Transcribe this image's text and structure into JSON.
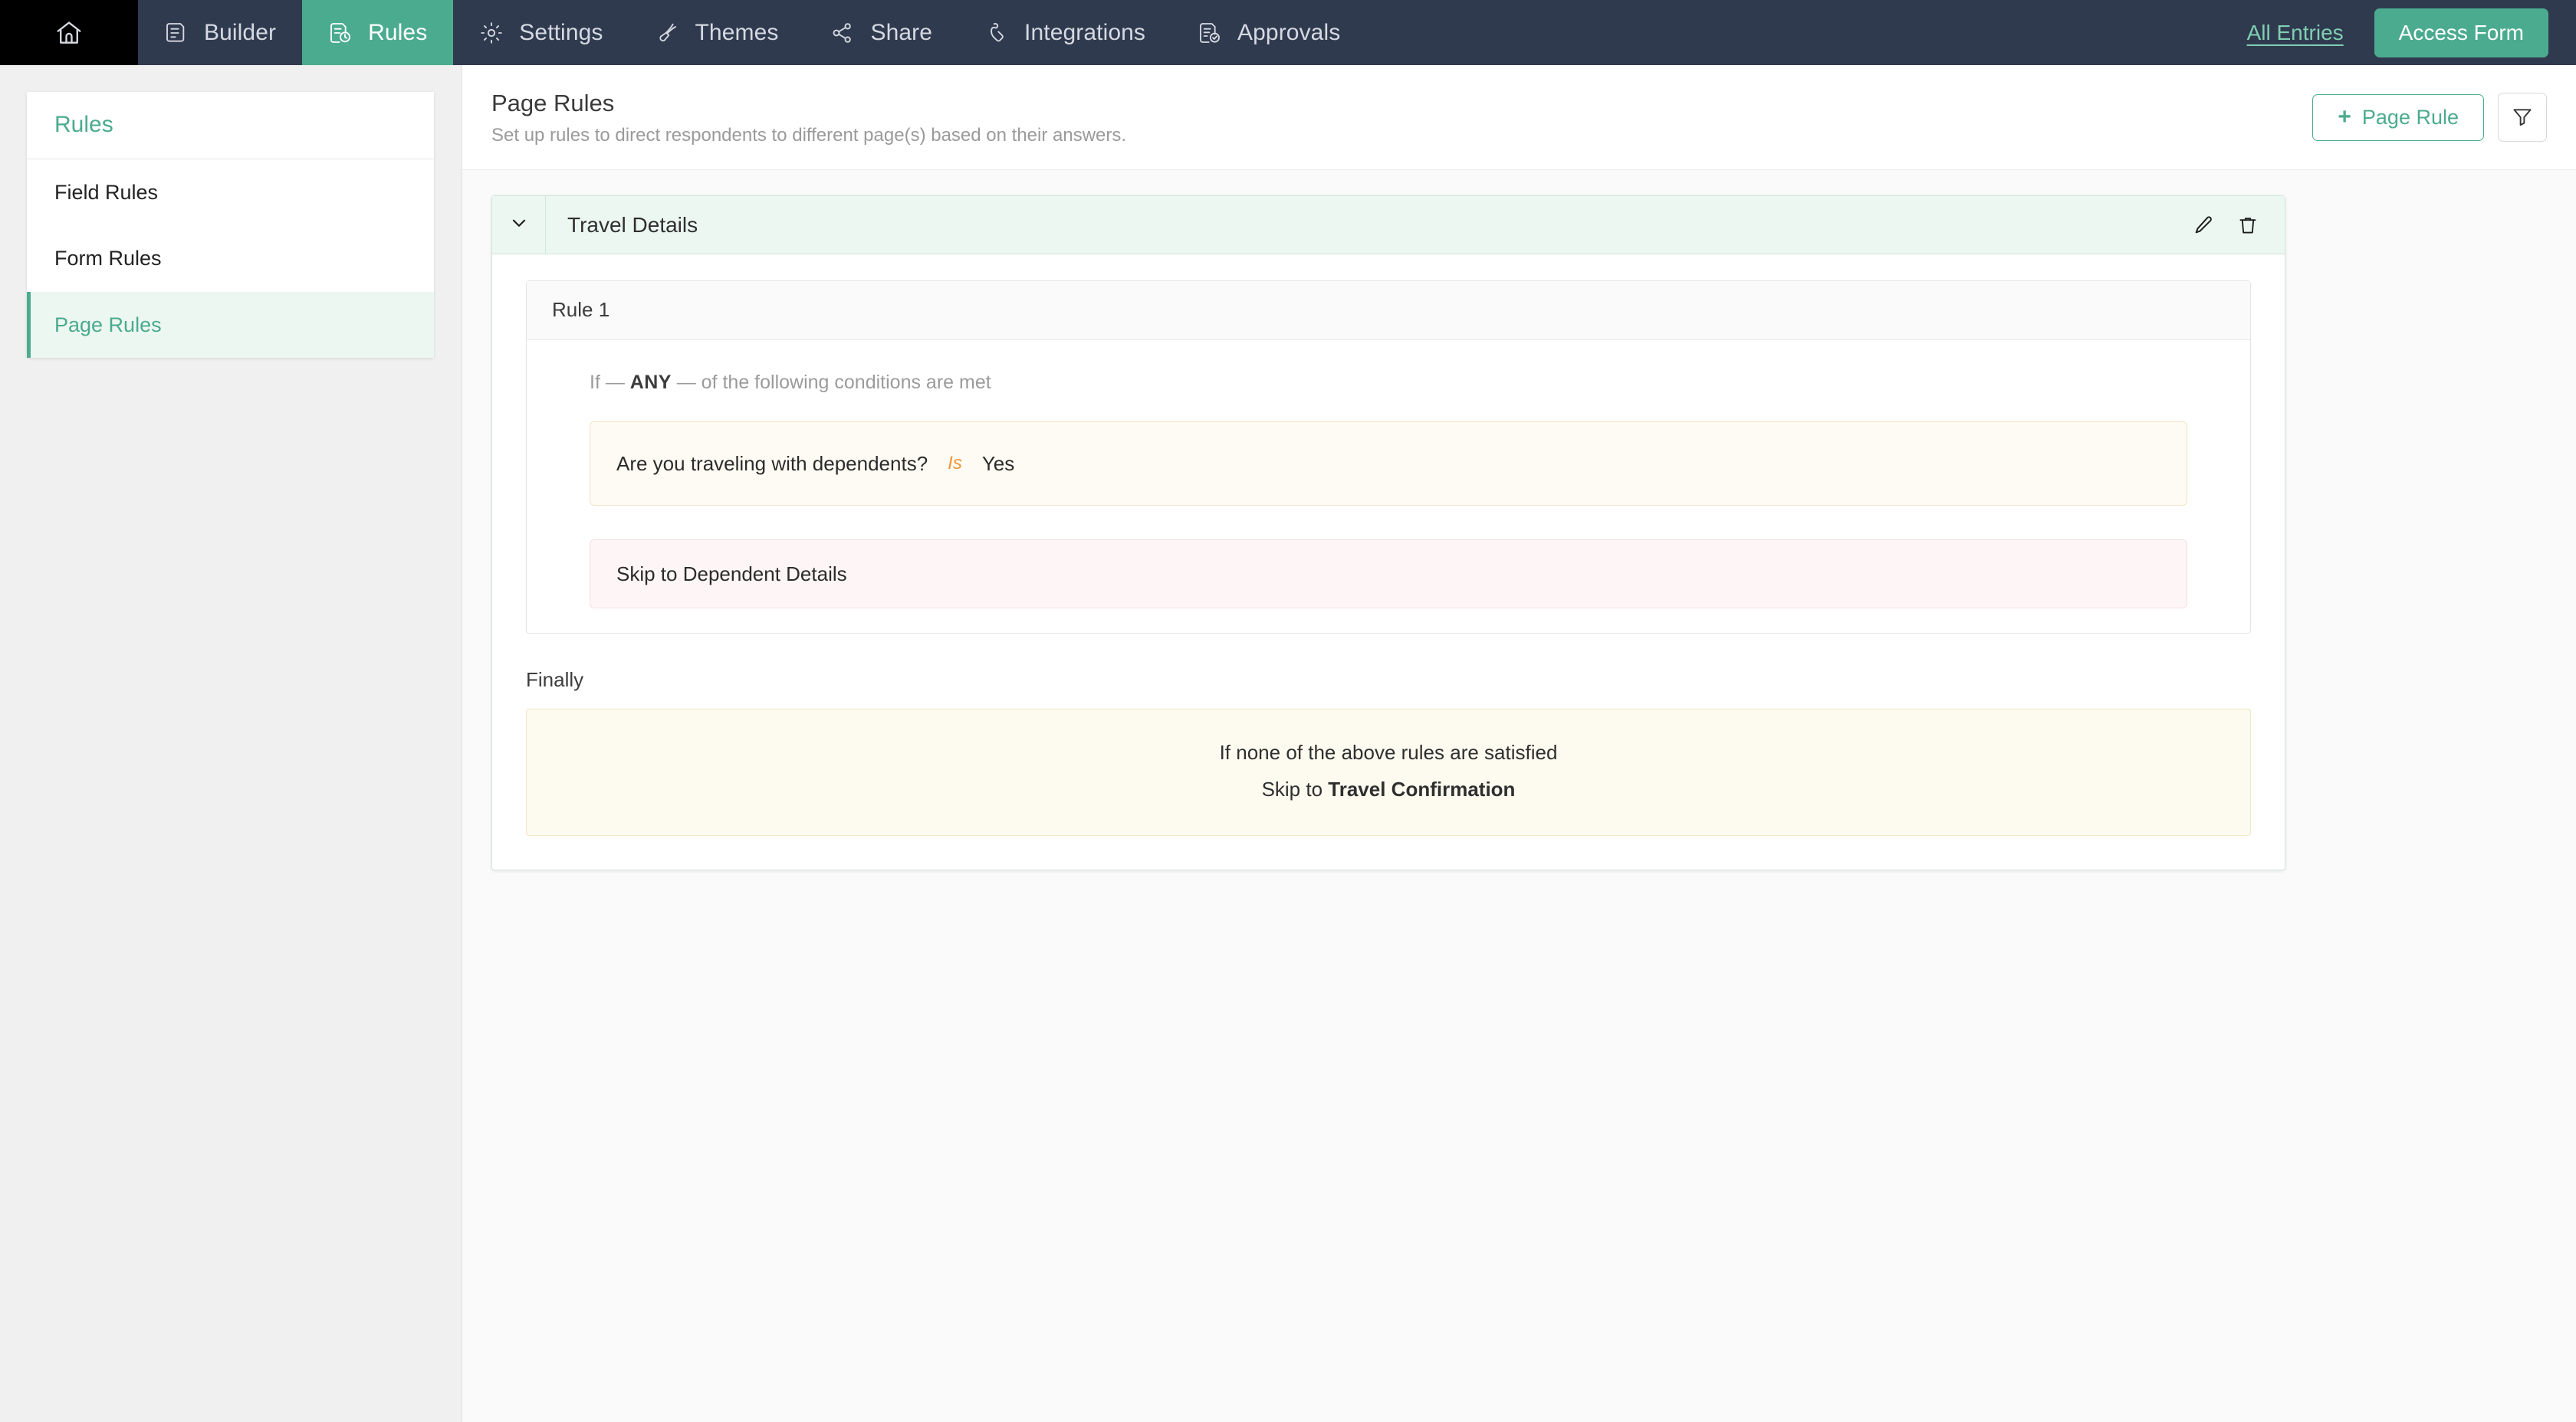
{
  "topnav": {
    "home_icon": "home-icon",
    "tabs": [
      {
        "label": "Builder",
        "icon": "builder-icon",
        "active": false
      },
      {
        "label": "Rules",
        "icon": "rules-icon",
        "active": true
      },
      {
        "label": "Settings",
        "icon": "gear-icon",
        "active": false
      },
      {
        "label": "Themes",
        "icon": "brush-icon",
        "active": false
      },
      {
        "label": "Share",
        "icon": "share-icon",
        "active": false
      },
      {
        "label": "Integrations",
        "icon": "plug-icon",
        "active": false
      },
      {
        "label": "Approvals",
        "icon": "approvals-icon",
        "active": false
      }
    ],
    "all_entries_label": "All Entries",
    "access_form_label": "Access Form",
    "accent_color": "#4bab8e",
    "bar_color": "#303a4f"
  },
  "sidebar": {
    "title": "Rules",
    "items": [
      {
        "label": "Field Rules",
        "active": false
      },
      {
        "label": "Form Rules",
        "active": false
      },
      {
        "label": "Page Rules",
        "active": true
      }
    ]
  },
  "header": {
    "title": "Page Rules",
    "subtitle": "Set up rules to direct respondents to different page(s) based on their answers.",
    "add_rule_label": "Page Rule",
    "add_rule_plus": "+",
    "filter_icon": "filter-icon"
  },
  "rule_group": {
    "name": "Travel Details",
    "collapse_icon": "chevron-down-icon",
    "edit_icon": "pencil-icon",
    "delete_icon": "trash-icon",
    "rules": [
      {
        "title": "Rule 1",
        "if_prefix": "If —",
        "match_type": "ANY",
        "if_suffix": "— of the following conditions are met",
        "conditions": [
          {
            "field": "Are you traveling with dependents?",
            "operator": "Is",
            "value": "Yes"
          }
        ],
        "actions": [
          {
            "text": "Skip to Dependent Details"
          }
        ]
      }
    ],
    "finally": {
      "label": "Finally",
      "line1": "If none of the above rules are satisfied",
      "line2_prefix": "Skip to ",
      "line2_target": "Travel Confirmation"
    }
  }
}
